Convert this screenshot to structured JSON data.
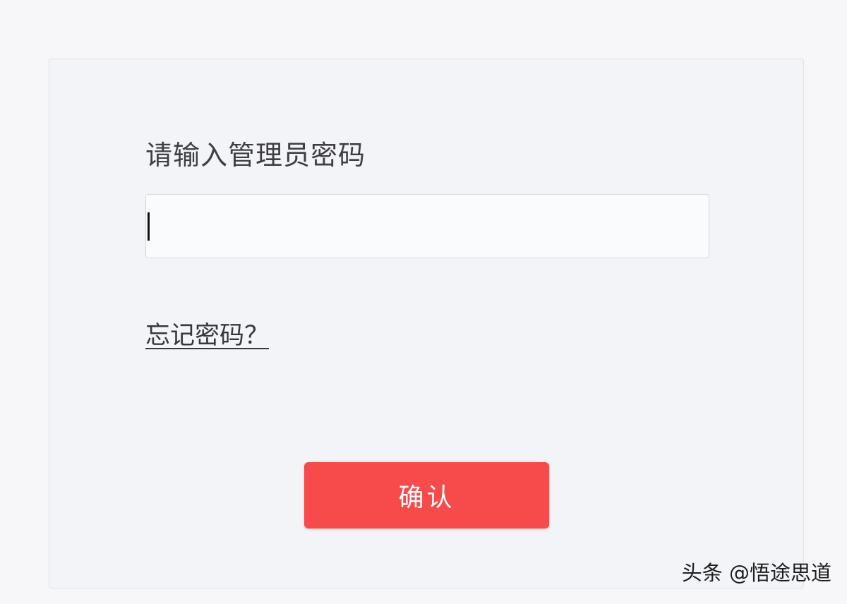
{
  "login_panel": {
    "prompt_label": "请输入管理员密码",
    "password_input": {
      "value": "",
      "placeholder": ""
    },
    "forgot_password_link": "忘记密码？",
    "confirm_button_label": "确认"
  },
  "watermark": {
    "text": "头条 @悟途思道"
  },
  "colors": {
    "background": "#f7f7f9",
    "panel_background": "#f3f4f7",
    "panel_border": "#dfe1e6",
    "input_background": "#fafbfd",
    "button_background": "#f74a4a",
    "button_text": "#ffffff",
    "label_text": "#3f3f43"
  }
}
